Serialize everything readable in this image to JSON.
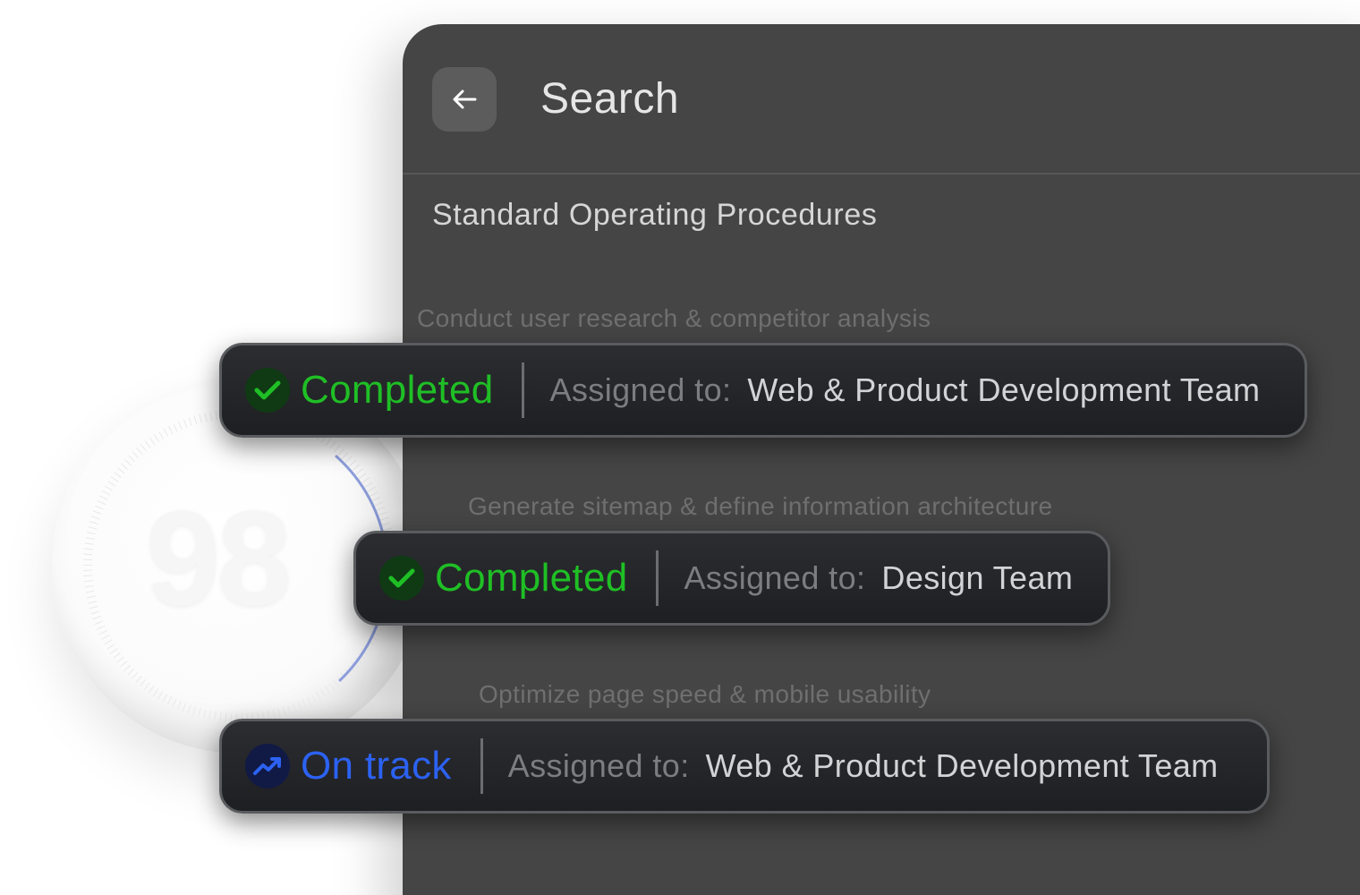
{
  "dial": {
    "score": "98",
    "icon": "score-dial"
  },
  "header": {
    "back_icon": "arrow-left-icon",
    "title": "Search"
  },
  "section": {
    "title": "Standard Operating Procedures"
  },
  "tasks": [
    {
      "name": "Conduct user research & competitor analysis",
      "status": "Completed",
      "status_icon": "checkmark-icon",
      "status_color": "#1fbf25",
      "assigned_label": "Assigned to:",
      "team": "Web & Product Development Team"
    },
    {
      "name": "Generate sitemap & define information architecture",
      "status": "Completed",
      "status_icon": "checkmark-icon",
      "status_color": "#1fbf25",
      "assigned_label": "Assigned to:",
      "team": "Design Team"
    },
    {
      "name": "Optimize page speed & mobile usability",
      "status": "On track",
      "status_icon": "trending-up-icon",
      "status_color": "#2c62f2",
      "assigned_label": "Assigned to:",
      "team": "Web & Product Development Team"
    }
  ],
  "colors": {
    "panel_bg": "#454545",
    "pill_bg": "#1e1f22",
    "completed": "#1fbf25",
    "on_track": "#2c62f2"
  }
}
